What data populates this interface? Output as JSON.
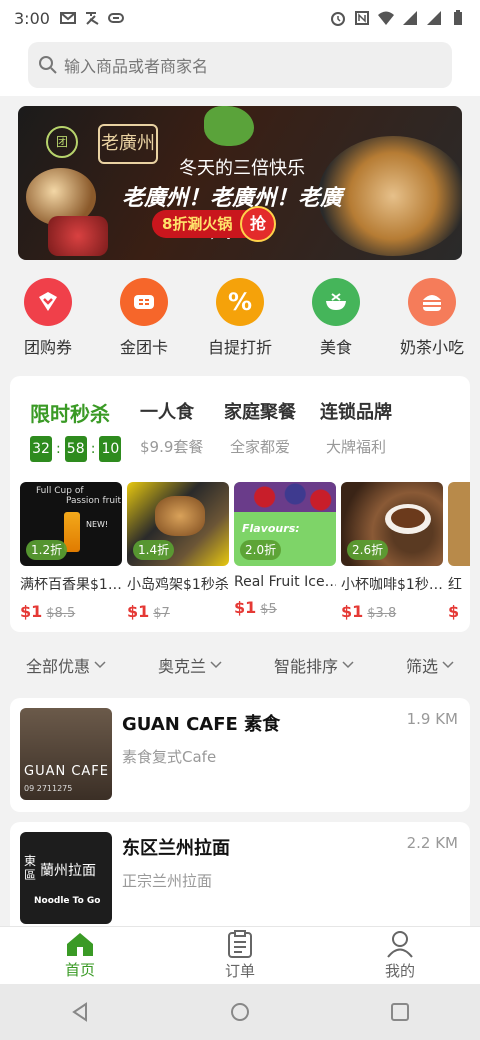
{
  "status_bar": {
    "time": "3:00"
  },
  "search": {
    "placeholder": "输入商品或者商家名"
  },
  "banner": {
    "brand": "老廣州",
    "tagline": "冬天的三倍快乐",
    "headline": "老廣州！老廣州！老廣州！",
    "promo": "8折涮火锅",
    "grab": "抢"
  },
  "quick_links": [
    {
      "label": "团购券",
      "icon": "voucher-icon",
      "color": "#f0404a"
    },
    {
      "label": "金团卡",
      "icon": "card-icon",
      "color": "#f6662a"
    },
    {
      "label": "自提打折",
      "icon": "percent-icon",
      "color": "#f5a20a"
    },
    {
      "label": "美食",
      "icon": "bowl-icon",
      "color": "#45b55a"
    },
    {
      "label": "奶茶小吃",
      "icon": "burger-icon",
      "color": "#f57c5a"
    }
  ],
  "flash_sale": {
    "title": "限时秒杀",
    "timer": {
      "h": "32",
      "m": "58",
      "s": "10"
    },
    "categories": [
      {
        "title": "一人食",
        "subtitle": "$9.9套餐"
      },
      {
        "title": "家庭聚餐",
        "subtitle": "全家都爱"
      },
      {
        "title": "连锁品牌",
        "subtitle": "大牌福利"
      }
    ],
    "products": [
      {
        "name": "满杯百香果$1…",
        "badge": "1.2折",
        "price": "$1",
        "old_price": "$8.5"
      },
      {
        "name": "小岛鸡架$1秒杀",
        "badge": "1.4折",
        "price": "$1",
        "old_price": "$7"
      },
      {
        "name": "Real Fruit Ice…",
        "badge": "2.0折",
        "price": "$1",
        "old_price": "$5"
      },
      {
        "name": "小杯咖啡$1秒…",
        "badge": "2.6折",
        "price": "$1",
        "old_price": "$3.8"
      },
      {
        "name": "红",
        "badge": "",
        "price": "$",
        "old_price": ""
      }
    ],
    "product_image_text": {
      "p1_line1": "Full Cup of",
      "p1_line2": "Passion fruit",
      "p1_new": "NEW!",
      "p3_flavours": "Flavours:"
    }
  },
  "filters": [
    {
      "label": "全部优惠"
    },
    {
      "label": "奥克兰"
    },
    {
      "label": "智能排序"
    },
    {
      "label": "筛选"
    }
  ],
  "stores": [
    {
      "name": "GUAN CAFE 素食",
      "desc": "素食复式Cafe",
      "distance": "1.9 KM",
      "img_text": "GUAN CAFE",
      "img_phone": "09 2711275"
    },
    {
      "name": "东区兰州拉面",
      "desc": "正宗兰州拉面",
      "distance": "2.2 KM",
      "img_text": "蘭州拉面",
      "img_sub": "Noodle To Go",
      "img_side": "東 區"
    }
  ],
  "tabs": [
    {
      "label": "首页",
      "active": true
    },
    {
      "label": "订单",
      "active": false
    },
    {
      "label": "我的",
      "active": false
    }
  ]
}
